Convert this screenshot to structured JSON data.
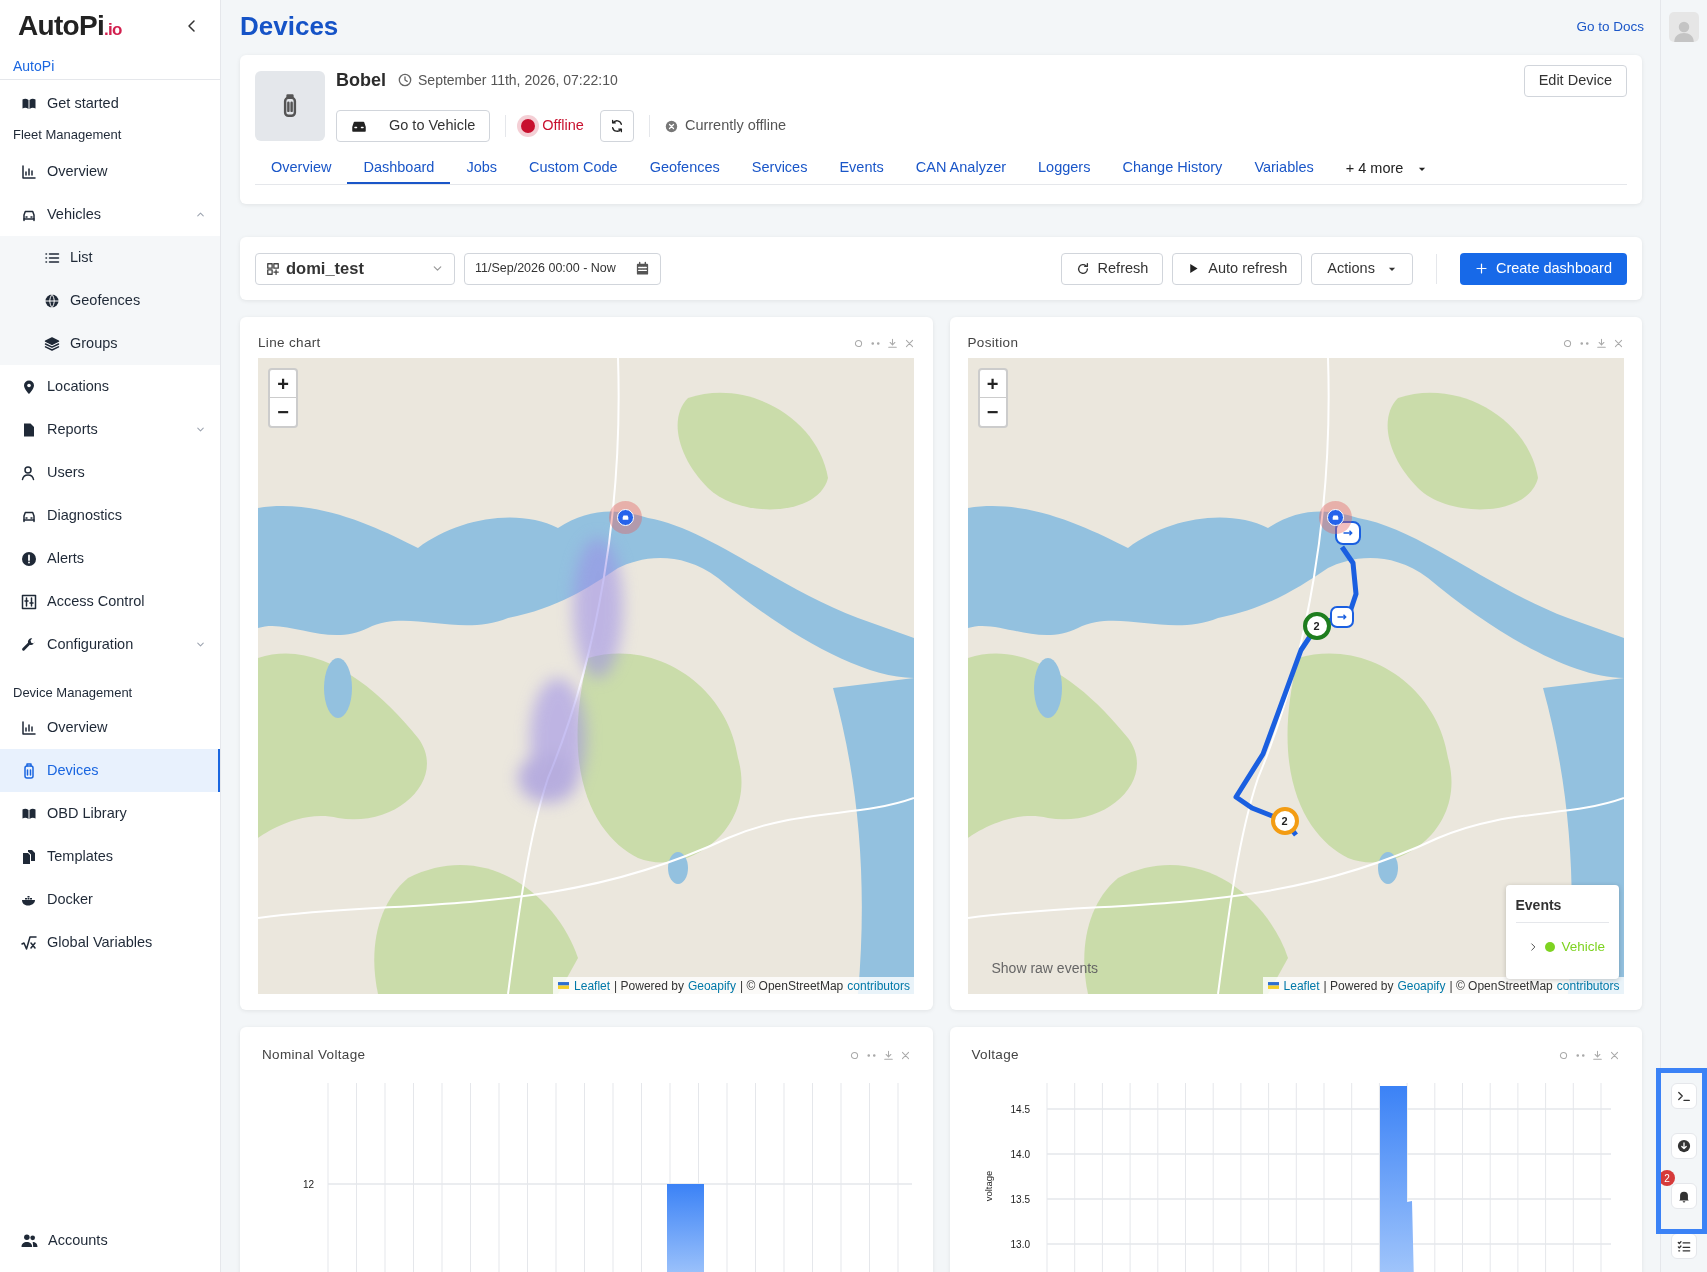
{
  "sidebar": {
    "logo": "AutoPi",
    "logo_suffix": ".io",
    "organization": "AutoPi",
    "nav": [
      {
        "kind": "item",
        "label": "Get started",
        "selected": false
      },
      {
        "kind": "heading",
        "label": "Fleet Management"
      },
      {
        "kind": "item",
        "label": "Overview",
        "selected": false
      },
      {
        "kind": "item",
        "label": "Vehicles",
        "selected": false,
        "expanded": true,
        "children": [
          {
            "label": "List",
            "selected": false
          },
          {
            "label": "Geofences",
            "selected": false
          },
          {
            "label": "Groups",
            "selected": false
          }
        ]
      },
      {
        "kind": "item",
        "label": "Locations",
        "selected": false
      },
      {
        "kind": "item",
        "label": "Reports",
        "selected": false,
        "expanded": false
      },
      {
        "kind": "item",
        "label": "Users",
        "selected": false
      },
      {
        "kind": "item",
        "label": "Diagnostics",
        "selected": false
      },
      {
        "kind": "item",
        "label": "Alerts",
        "selected": false
      },
      {
        "kind": "item",
        "label": "Access Control",
        "selected": false
      },
      {
        "kind": "item",
        "label": "Configuration",
        "selected": false,
        "expanded": false
      },
      {
        "kind": "heading",
        "label": "Device Management"
      },
      {
        "kind": "item",
        "label": "Overview",
        "selected": false
      },
      {
        "kind": "item",
        "label": "Devices",
        "selected": true
      },
      {
        "kind": "item",
        "label": "OBD Library",
        "selected": false
      },
      {
        "kind": "item",
        "label": "Templates",
        "selected": false
      },
      {
        "kind": "item",
        "label": "Docker",
        "selected": false
      },
      {
        "kind": "item",
        "label": "Global Variables",
        "selected": false
      }
    ],
    "account": "Accounts"
  },
  "page_title": "Devices",
  "docs_link": "Go to Docs",
  "device": {
    "name": "Bobel",
    "timestamp": "September 11th, 2026, 07:22:10",
    "vehicle_button": "Go to Vehicle",
    "status": "Offline",
    "online": false,
    "connection": "Currently offline",
    "edit_button": "Edit Device",
    "tabs": [
      {
        "label": "Overview",
        "selected": false
      },
      {
        "label": "Dashboard",
        "selected": true
      },
      {
        "label": "Jobs",
        "selected": false
      },
      {
        "label": "Custom Code",
        "selected": false
      },
      {
        "label": "Geofences",
        "selected": false
      },
      {
        "label": "Services",
        "selected": false
      },
      {
        "label": "Events",
        "selected": false
      },
      {
        "label": "CAN Analyzer",
        "selected": false
      },
      {
        "label": "Loggers",
        "selected": false
      },
      {
        "label": "Change History",
        "selected": false
      },
      {
        "label": "Variables",
        "selected": false
      }
    ],
    "more_tabs": "+ 4 more"
  },
  "dashboard": {
    "name": "domi_test",
    "date_range": "11/Sep/2026 00:00 - Now",
    "refresh": "Refresh",
    "auto_refresh": "Auto refresh",
    "actions": "Actions",
    "create": "Create dashboard"
  },
  "widgets": [
    {
      "kind": "heatmap",
      "title": "Line chart",
      "zoom_in": "+",
      "zoom_out": "−",
      "attribution": [
        {
          "text": "Leaflet",
          "link": true
        },
        {
          "text": "| Powered by",
          "link": false
        },
        {
          "text": "Geoapify",
          "link": true
        },
        {
          "text": "| © OpenStreetMap",
          "link": false
        },
        {
          "text": "contributors",
          "link": true
        }
      ]
    },
    {
      "kind": "route",
      "title": "Position",
      "zoom_in": "+",
      "zoom_out": "−",
      "clusters": [
        {
          "label": "2",
          "color": "#1e7d1e"
        },
        {
          "label": "2",
          "color": "#f39c12"
        }
      ],
      "raw_events": "Show raw events",
      "events_panel": {
        "title": "Events",
        "items": [
          {
            "label": "Vehicle",
            "color": "#7ed321"
          }
        ]
      },
      "attribution": [
        {
          "text": "Leaflet",
          "link": true
        },
        {
          "text": "| Powered by",
          "link": false
        },
        {
          "text": "Geoapify",
          "link": true
        },
        {
          "text": "| © OpenStreetMap",
          "link": false
        },
        {
          "text": "contributors",
          "link": true
        }
      ]
    },
    {
      "kind": "bars",
      "title": "Nominal Voltage",
      "y_ticks": [
        "12"
      ]
    },
    {
      "kind": "area",
      "title": "Voltage",
      "y_label": "voltage",
      "y_ticks": [
        "14.5",
        "14.0",
        "13.5",
        "13.0"
      ]
    }
  ],
  "rail": {
    "notifications": "2"
  }
}
